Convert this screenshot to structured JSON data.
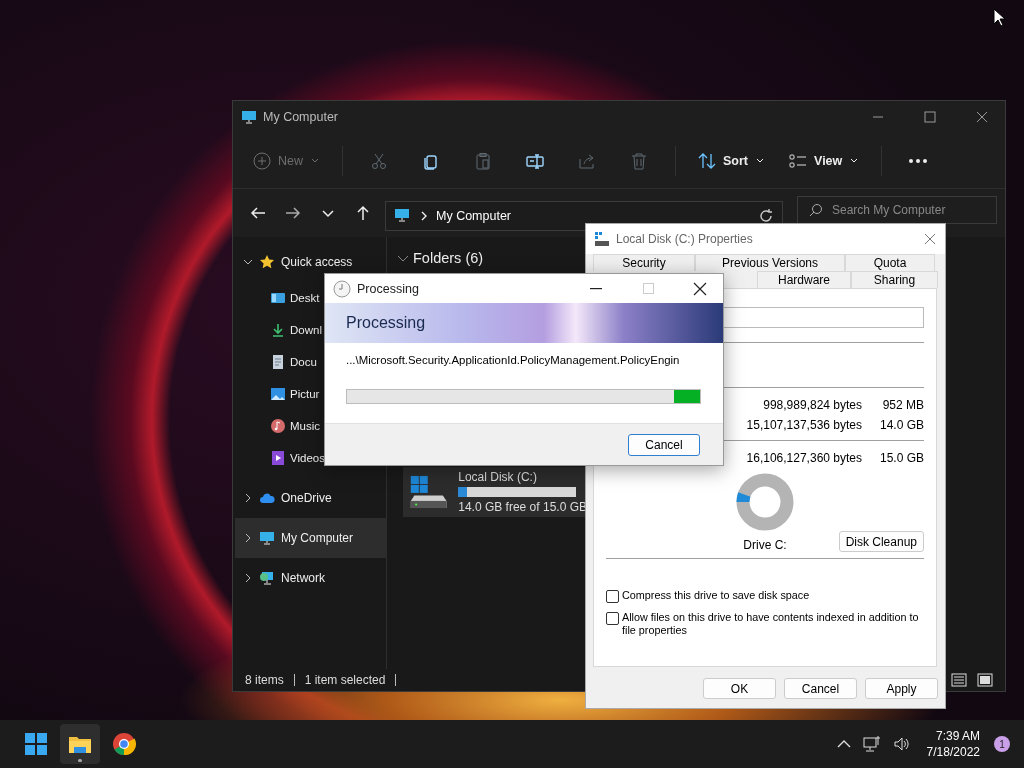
{
  "explorer": {
    "title": "My Computer",
    "toolbar": {
      "new": {
        "label": "New",
        "disabled": true
      },
      "actions": [
        {
          "kind": "cut",
          "disabled": true
        },
        {
          "kind": "copy",
          "disabled": false
        },
        {
          "kind": "paste",
          "disabled": true
        },
        {
          "kind": "rename",
          "disabled": false
        },
        {
          "kind": "share",
          "disabled": true
        },
        {
          "kind": "delete",
          "disabled": true
        }
      ],
      "sort": "Sort",
      "view": "View"
    },
    "address": "My Computer",
    "search": {
      "placeholder": "Search My Computer"
    },
    "sidebar": [
      {
        "label": "Quick access",
        "kind": "star",
        "expanded": true,
        "selected": false,
        "children": [
          {
            "label": "Deskt",
            "kind": "desktop",
            "selected": false
          },
          {
            "label": "Downl",
            "kind": "downloads",
            "selected": false
          },
          {
            "label": "Docu",
            "kind": "documents",
            "selected": false
          },
          {
            "label": "Pictur",
            "kind": "pictures",
            "selected": false
          },
          {
            "label": "Music",
            "kind": "music",
            "selected": false
          },
          {
            "label": "Videos",
            "kind": "videos",
            "selected": false
          }
        ]
      },
      {
        "label": "OneDrive",
        "kind": "cloud",
        "expanded": false,
        "selected": false
      },
      {
        "label": "My Computer",
        "kind": "computer",
        "expanded": false,
        "selected": true
      },
      {
        "label": "Network",
        "kind": "network",
        "expanded": false,
        "selected": false
      }
    ],
    "sections": [
      {
        "label": "Folders (6)",
        "expanded": true
      }
    ],
    "drives": [
      {
        "name": "Local Disk (C:)",
        "level": 0.07,
        "free": "14.0 GB free of 15.0 GB",
        "selected": true
      }
    ],
    "status": {
      "items": "8 items",
      "selection": "1 item selected"
    }
  },
  "properties": {
    "title": "Local Disk (C:) Properties",
    "tabs_row1": [
      {
        "label": "Security",
        "selected": false
      },
      {
        "label": "Previous Versions",
        "selected": false
      },
      {
        "label": "Quota",
        "selected": false
      }
    ],
    "tabs_row2": [
      {
        "label": "Hardware",
        "selected": false
      },
      {
        "label": "Sharing",
        "selected": false
      }
    ],
    "usage": [
      {
        "bytes": "998,989,824 bytes",
        "size": "952 MB"
      },
      {
        "bytes": "15,107,137,536 bytes",
        "size": "14.0 GB"
      }
    ],
    "capacity": {
      "bytes": "16,106,127,360 bytes",
      "size": "15.0 GB"
    },
    "drive_label": "Drive C:",
    "cleanup": "Disk Cleanup",
    "options": [
      {
        "label": "Compress this drive to save disk space",
        "checked": false
      },
      {
        "label": "Allow files on this drive to have contents indexed in addition to file properties",
        "checked": false
      }
    ],
    "buttons": [
      "OK",
      "Cancel",
      "Apply"
    ]
  },
  "processing": {
    "title": "Processing",
    "heading": "Processing",
    "path": "...\\Microsoft.Security.ApplicationId.PolicyManagement.PolicyEngin",
    "cancel": "Cancel"
  },
  "taskbar": {
    "apps": [
      {
        "kind": "start",
        "active": false
      },
      {
        "kind": "explorer",
        "active": true
      },
      {
        "kind": "chrome",
        "active": false
      }
    ],
    "time": "7:39 AM",
    "date": "7/18/2022",
    "notifications": "1"
  }
}
